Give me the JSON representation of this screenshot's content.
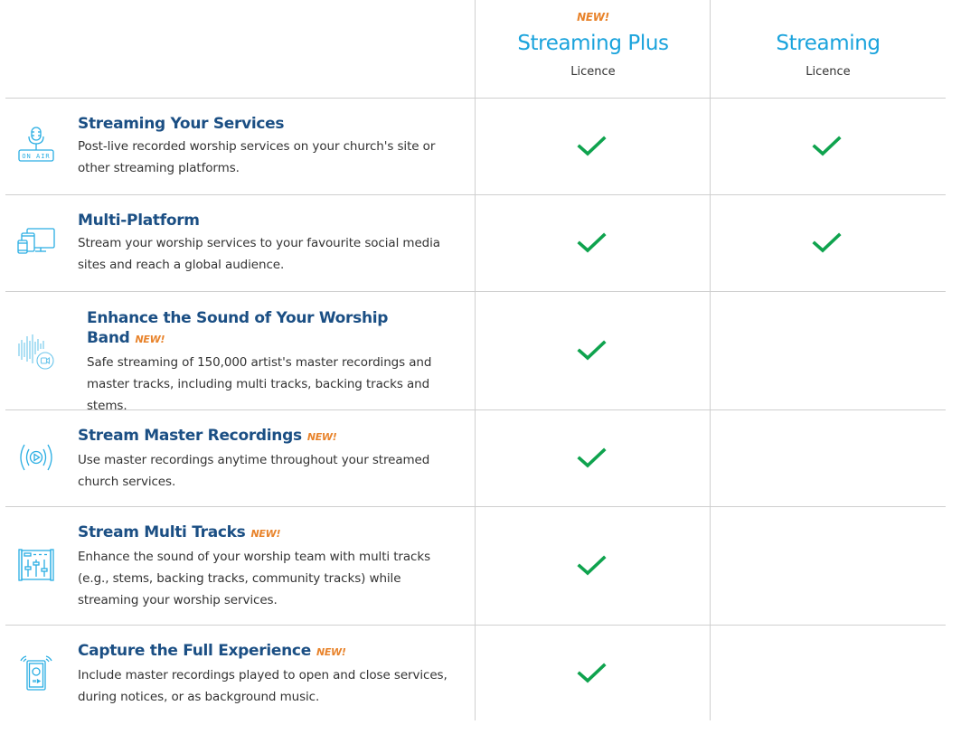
{
  "colors": {
    "accent_blue": "#1aa3dc",
    "title_navy": "#1b4f84",
    "new_orange": "#e8832b",
    "check_green": "#0fa34e",
    "divider": "#cfcfcf"
  },
  "header": {
    "columns": [
      {
        "new_label": "NEW!",
        "title": "Streaming Plus",
        "subtitle": "Licence"
      },
      {
        "new_label": "",
        "title": "Streaming",
        "subtitle": "Licence"
      }
    ]
  },
  "features": [
    {
      "icon": "on-air-microphone-icon",
      "icon_text": "ON AIR",
      "title": "Streaming Your Services",
      "new_label": "",
      "description": "Post-live recorded worship services on your church's site or other streaming platforms.",
      "streaming_plus": true,
      "streaming": true
    },
    {
      "icon": "multi-device-icon",
      "title": "Multi-Platform",
      "new_label": "",
      "description": "Stream your worship services to your favourite social media sites and reach a global audience.",
      "streaming_plus": true,
      "streaming": true
    },
    {
      "icon": "sound-wave-video-icon",
      "title": "Enhance the Sound of Your Worship Band",
      "new_label": "NEW!",
      "description": "Safe streaming of 150,000 artist's master recordings and master tracks, including multi tracks, backing tracks and stems.",
      "streaming_plus": true,
      "streaming": false
    },
    {
      "icon": "broadcast-play-icon",
      "title": "Stream Master Recordings",
      "new_label": "NEW!",
      "description": "Use master recordings anytime throughout your streamed church services.",
      "streaming_plus": true,
      "streaming": false
    },
    {
      "icon": "mixer-sliders-icon",
      "title": "Stream Multi Tracks",
      "new_label": "NEW!",
      "description": "Enhance the sound of your worship team with multi tracks (e.g., stems, backing tracks, community tracks) while streaming your worship services.",
      "streaming_plus": true,
      "streaming": false
    },
    {
      "icon": "speaker-device-icon",
      "title": "Capture the Full Experience",
      "new_label": "NEW!",
      "description": "Include master recordings played to open and close services, during notices, or as background music.",
      "streaming_plus": true,
      "streaming": false
    }
  ]
}
